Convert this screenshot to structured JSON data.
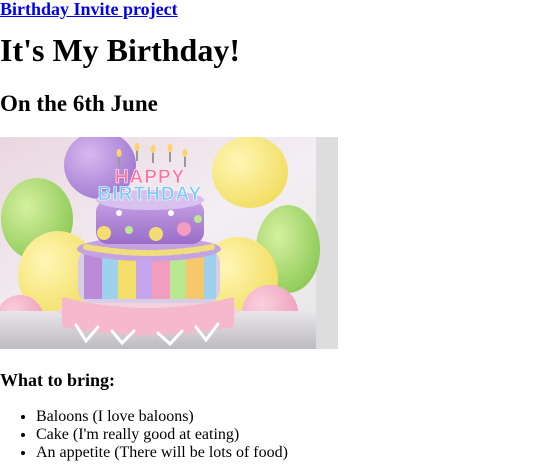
{
  "header": {
    "project_link": "Birthday Invite project"
  },
  "main": {
    "title": "It's My Birthday!",
    "subtitle": "On the 6th June",
    "bring_heading": "What to bring:",
    "bring_items": [
      "Baloons (I love baloons)",
      "Cake (I'm really good at eating)",
      "An appetite (There will be lots of food)"
    ]
  },
  "image": {
    "cake_topper_text": "HAPPY BIRTHDAY"
  },
  "colors": {
    "link": "#0000ee",
    "text": "#000000",
    "background": "#ffffff"
  }
}
